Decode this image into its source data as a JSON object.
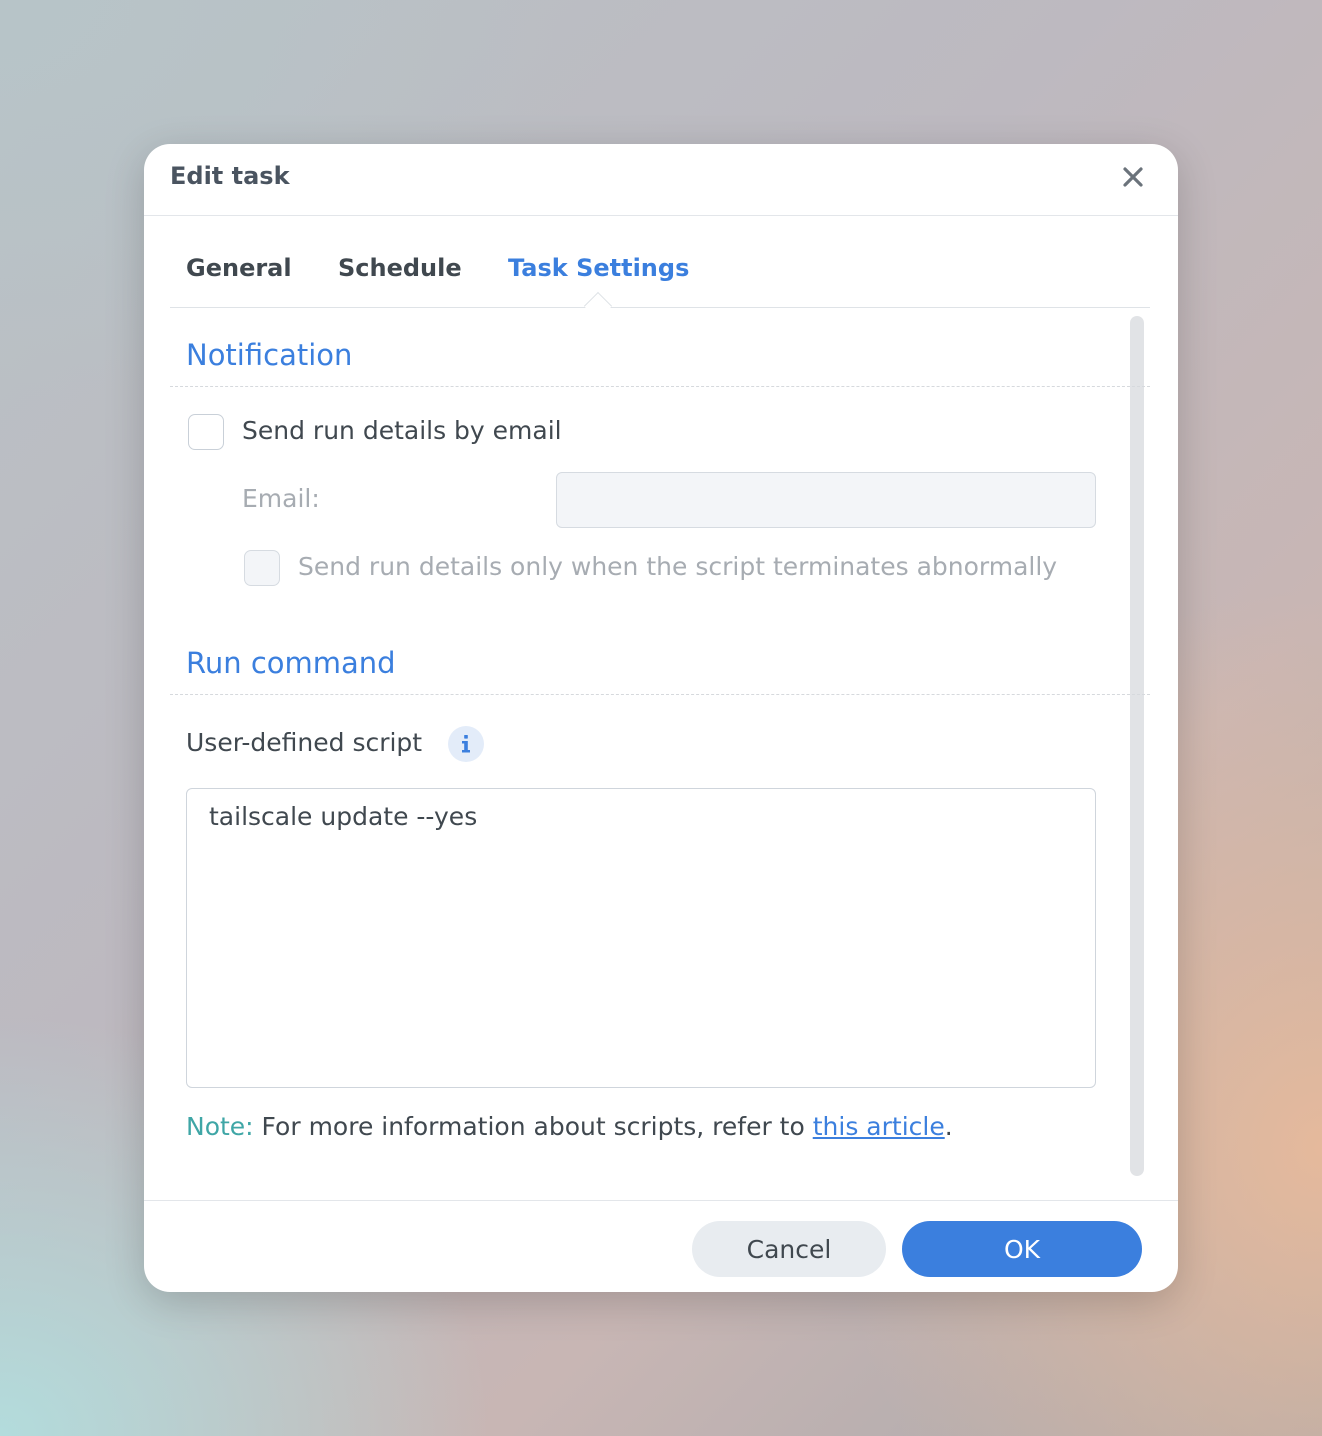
{
  "dialog": {
    "title": "Edit task",
    "close_icon": "close-icon"
  },
  "tabs": [
    {
      "label": "General",
      "active": false
    },
    {
      "label": "Schedule",
      "active": false
    },
    {
      "label": "Task Settings",
      "active": true
    }
  ],
  "notification": {
    "section_title": "Notification",
    "send_email_label": "Send run details by email",
    "send_email_checked": false,
    "email_label": "Email:",
    "email_value": "",
    "abnormal_only_label": "Send run details only when the script terminates abnormally",
    "abnormal_only_checked": false
  },
  "run_command": {
    "section_title": "Run command",
    "script_label": "User-defined script",
    "script_value": "tailscale update --yes",
    "note_prefix": "Note:",
    "note_text": " For more information about scripts, refer to ",
    "note_link": "this article",
    "note_suffix": "."
  },
  "footer": {
    "cancel_label": "Cancel",
    "ok_label": "OK"
  },
  "colors": {
    "accent": "#3b7fde",
    "note": "#3fa6a6",
    "text": "#40484f"
  }
}
